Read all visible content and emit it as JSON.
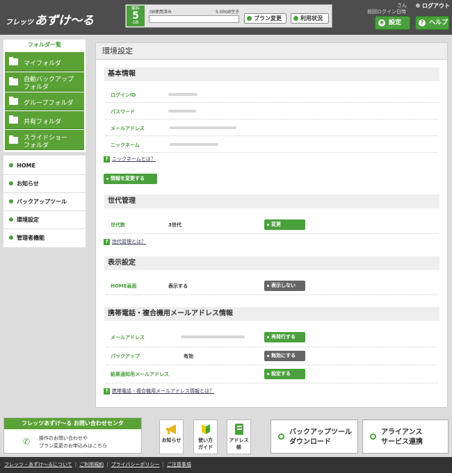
{
  "header": {
    "logo_small": "フレッツ",
    "logo_main": "あずけ〜る",
    "quota": {
      "label": "無料",
      "size": "5",
      "unit": "GB",
      "used": "0B使用済み",
      "free": "5.00GB空き",
      "used_fraction": 0
    },
    "plan_change": "プラン変更",
    "usage_status": "利用状況",
    "user_suffix": "さん",
    "last_login": "前回ログイン日時",
    "logout": "ログアウト",
    "settings": "設定",
    "help": "ヘルプ"
  },
  "sidebar": {
    "folders_title": "フォルダ一覧",
    "folders": [
      {
        "label": "マイフォルダ"
      },
      {
        "label": "自動バックアップ",
        "label2": "フォルダ"
      },
      {
        "label": "グループフォルダ"
      },
      {
        "label": "共有フォルダ"
      },
      {
        "label": "スライドショー",
        "label2": "フォルダ"
      }
    ],
    "menu": [
      "HOME",
      "お知らせ",
      "バックアップツール",
      "環境設定",
      "管理者機能"
    ]
  },
  "main": {
    "title": "環境設定",
    "basic": {
      "heading": "基本情報",
      "rows": [
        "ログインID",
        "パスワード",
        "メールアドレス",
        "ニックネーム"
      ],
      "help": "ニックネームとは？",
      "edit_button": "情報を変更する"
    },
    "generation": {
      "heading": "世代管理",
      "label": "世代数",
      "value": "3世代",
      "button": "変更",
      "help": "世代管理とは？"
    },
    "display": {
      "heading": "表示設定",
      "label": "HOME画面",
      "value": "表示する",
      "button": "表示しない"
    },
    "mobile": {
      "heading": "携帯電話・複合機用メールアドレス情報",
      "rows": [
        {
          "label": "メールアドレス",
          "value": "",
          "button": "再発行する"
        },
        {
          "label": "バックアップ",
          "value": "有効",
          "button": "無効にする"
        },
        {
          "label": "結果通知用メールアドレス",
          "value": "",
          "button": "設定する"
        }
      ],
      "help": "携帯電話・複合機用メールアドレス情報とは？"
    }
  },
  "bottom": {
    "contact_title": "フレッツあずけ〜る お問い合わせセンタ",
    "contact_line1": "操作のお問い合わせや",
    "contact_line2": "プラン変更のお申込みはこちら",
    "tiles": [
      {
        "label": "お知らせ",
        "icon": "megaphone-icon"
      },
      {
        "label": "使い方",
        "label2": "ガイド",
        "icon": "beginner-mark-icon"
      },
      {
        "label": "アドレス",
        "label2": "帳",
        "icon": "address-book-icon"
      }
    ],
    "backup_tool": {
      "line1": "バックアップツール",
      "line2": "ダウンロード"
    },
    "alliance": {
      "line1": "アライアンス",
      "line2": "サービス連携"
    }
  },
  "footer": {
    "links": [
      "フレッツ・あずけ〜るについて",
      "ご利用規約",
      "プライバシーポリシー",
      "ご注意事項"
    ]
  },
  "colors": {
    "accent": "#4aa03c",
    "header": "#4d4d4d",
    "footer": "#333333"
  }
}
